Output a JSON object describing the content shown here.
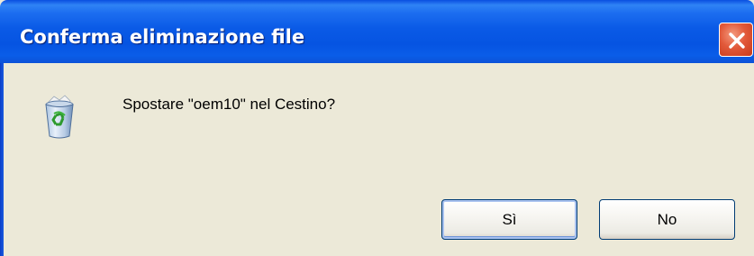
{
  "window": {
    "title": "Conferma eliminazione file",
    "close_icon": "close-icon"
  },
  "content": {
    "icon": "recycle-bin-icon",
    "message": "Spostare \"oem10\" nel Cestino?"
  },
  "buttons": {
    "yes_label": "Sì",
    "no_label": "No",
    "default": "yes"
  },
  "colors": {
    "titlebar": "#0a5ae6",
    "dialog_background": "#ece9d8",
    "close_button": "#e2593a",
    "button_border": "#003c74"
  }
}
